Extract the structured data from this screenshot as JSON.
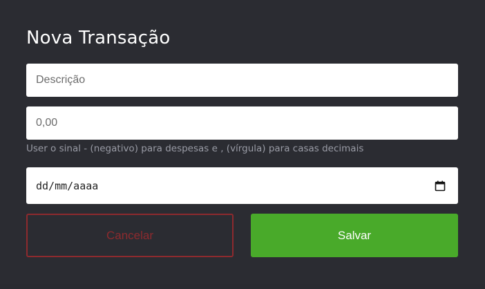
{
  "modal": {
    "title": "Nova Transação",
    "description_placeholder": "Descrição",
    "amount_placeholder": "0,00",
    "amount_help": "User o sinal - (negativo) para despesas e , (vírgula) para casas decimais",
    "date_placeholder": "dd/mm/aaaa",
    "date_icon": "calendar-icon",
    "cancel_label": "Cancelar",
    "save_label": "Salvar"
  },
  "colors": {
    "background": "#2b2c32",
    "cancel": "#8e2a2e",
    "save": "#49aa2a"
  }
}
